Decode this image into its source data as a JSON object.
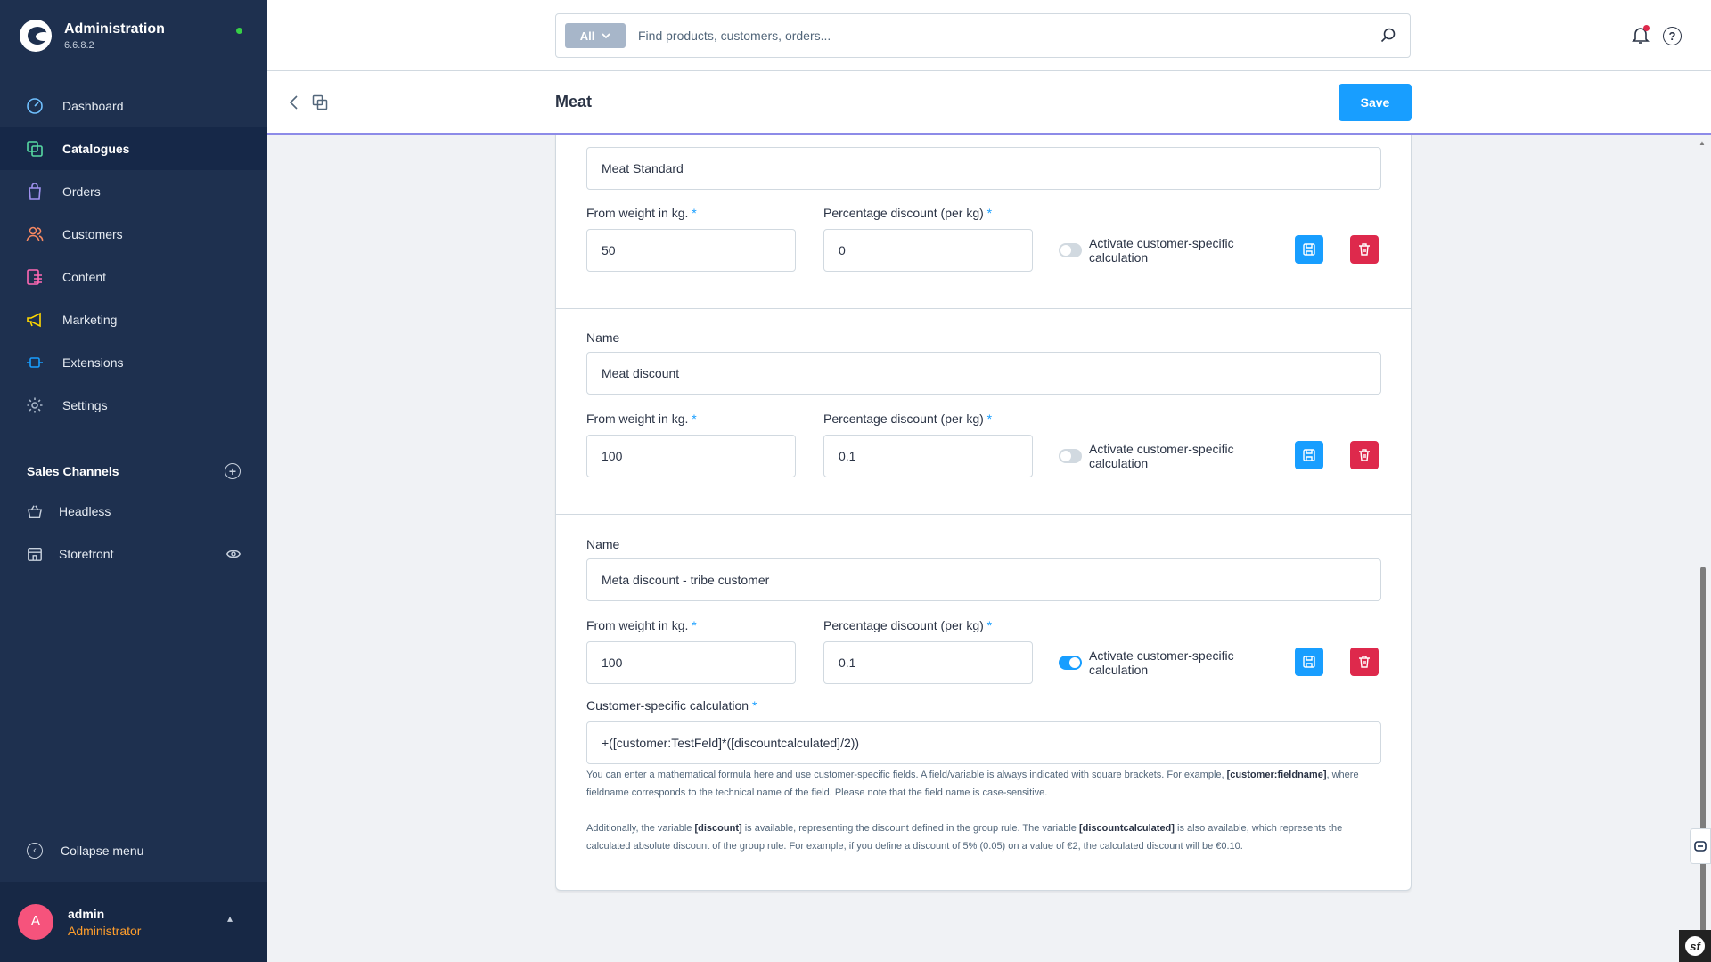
{
  "app": {
    "title": "Administration",
    "version": "6.6.8.2"
  },
  "sidebar": {
    "items": [
      {
        "label": "Dashboard",
        "icon": "gauge-icon",
        "active": false
      },
      {
        "label": "Catalogues",
        "icon": "catalogue-icon",
        "active": true
      },
      {
        "label": "Orders",
        "icon": "shopping-bag-icon",
        "active": false
      },
      {
        "label": "Customers",
        "icon": "users-icon",
        "active": false
      },
      {
        "label": "Content",
        "icon": "content-icon",
        "active": false
      },
      {
        "label": "Marketing",
        "icon": "megaphone-icon",
        "active": false
      },
      {
        "label": "Extensions",
        "icon": "plug-icon",
        "active": false
      },
      {
        "label": "Settings",
        "icon": "gear-icon",
        "active": false
      }
    ],
    "sales_channels_title": "Sales Channels",
    "sales_channels": [
      {
        "label": "Headless",
        "icon": "basket-icon"
      },
      {
        "label": "Storefront",
        "icon": "store-icon"
      }
    ],
    "collapse_label": "Collapse menu",
    "user": {
      "initial": "A",
      "name": "admin",
      "role": "Administrator"
    }
  },
  "search": {
    "type_label": "All",
    "placeholder": "Find products, customers, orders..."
  },
  "smartbar": {
    "title": "Meat",
    "save_label": "Save"
  },
  "labels": {
    "name": "Name",
    "from_weight": "From weight in kg.",
    "percentage_discount": "Percentage discount (per kg)",
    "required_mark": "*",
    "activate_line1": "Activate customer-specific",
    "activate_line2": "calculation",
    "customer_calc": "Customer-specific calculation"
  },
  "rules": [
    {
      "name": "Meat Standard",
      "from_weight": "50",
      "discount": "0",
      "customer_specific": false
    },
    {
      "name": "Meat discount",
      "from_weight": "100",
      "discount": "0.1",
      "customer_specific": false
    },
    {
      "name": "Meta discount - tribe customer",
      "from_weight": "100",
      "discount": "0.1",
      "customer_specific": true
    }
  ],
  "calculation": {
    "value": "+([customer:TestFeld]*([discountcalculated]/2))",
    "help1_a": "You can enter a mathematical formula here and use customer-specific fields. A field/variable is always indicated with square brackets. For example,",
    "help1_b": "[customer:fieldname]",
    "help1_c": ", where fieldname corresponds to the technical name of the field. Please note that the field name is case-sensitive.",
    "help2_a": "Additionally, the variable",
    "help2_b": "[discount]",
    "help2_c": "is available, representing the discount defined in the group rule. The variable",
    "help2_d": "[discountcalculated]",
    "help2_e": "is also available, which represents the calculated absolute discount of the group rule. For example, if you define a discount of 5% (0.05) on a value of €2, the calculated discount will be €0.10."
  },
  "colors": {
    "sidebar": "#1e304f",
    "accent": "#189eff",
    "danger": "#de294c",
    "role": "#ff9e2c"
  }
}
